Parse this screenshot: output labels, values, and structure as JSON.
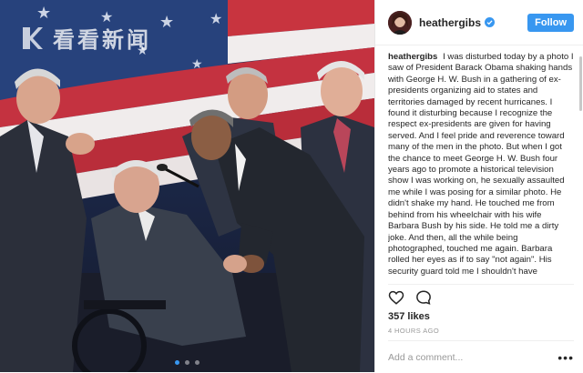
{
  "photo": {
    "watermark_text": "看看新闻",
    "carousel": {
      "count": 3,
      "active_index": 0
    }
  },
  "post": {
    "username": "heathergibs",
    "verified": true,
    "follow_label": "Follow",
    "caption": "I was disturbed today by a photo I saw of President Barack Obama shaking hands with George H. W. Bush in a gathering of ex-presidents organizing aid to states and territories damaged by recent hurricanes. I found it disturbing because I recognize the respect ex-presidents are given for having served. And I feel pride and reverence toward many of the men in the photo. But when I got the chance to meet George H. W. Bush four years ago to promote a historical television show I was working on, he sexually assaulted me while I was posing for a similar photo. He didn't shake my hand. He touched me from behind from his wheelchair with his wife Barbara Bush by his side. He told me a dirty joke. And then, all the while being photographed, touched me again. Barbara rolled her eyes as if to say \"not again\". His security guard told me I shouldn't have",
    "likes": "357 likes",
    "timestamp": "4 HOURS AGO",
    "comment_placeholder": "Add a comment...",
    "more_label": "•••"
  },
  "colors": {
    "accent": "#3897f0",
    "text": "#262626",
    "muted": "#999999"
  },
  "icons": [
    "heart-icon",
    "comment-icon",
    "verified-badge-icon",
    "more-options-icon",
    "kankan-logo-icon"
  ]
}
